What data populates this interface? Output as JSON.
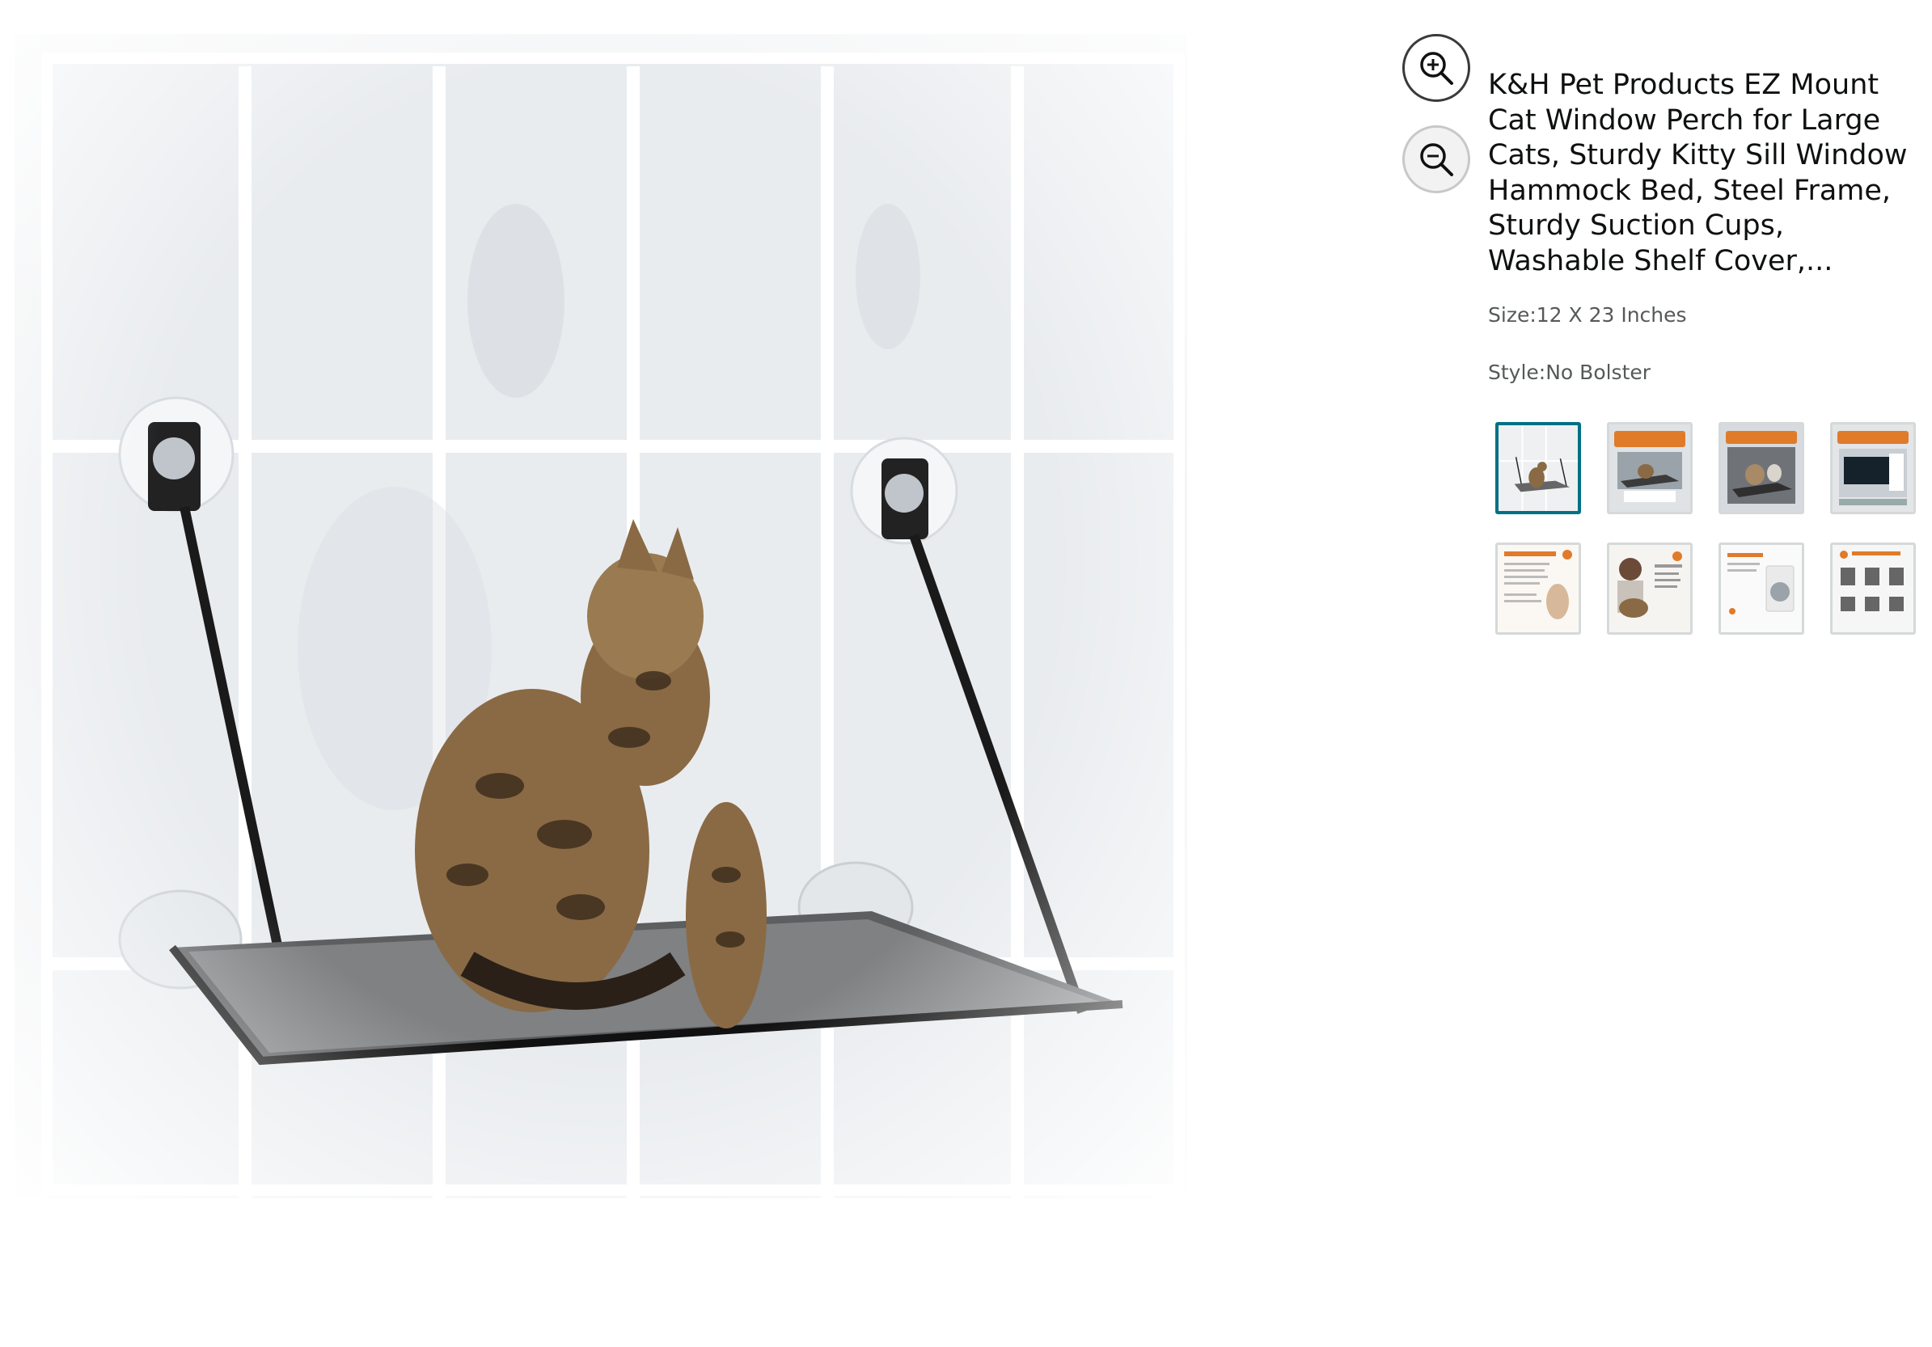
{
  "product": {
    "title": "K&H Pet Products EZ Mount Cat Window Perch for Large Cats, Sturdy Kitty Sill Window Hammock Bed, Steel Frame, Sturdy Suction Cups, Washable Shelf Cover,...",
    "size_label": "Size:",
    "size_value": "12 X 23 Inches",
    "style_label": "Style:",
    "style_value": "No Bolster"
  },
  "zoom": {
    "in_icon": "zoom-in-icon",
    "out_icon": "zoom-out-icon"
  },
  "thumbnails": {
    "count": 8,
    "selected_index": 0
  },
  "colors": {
    "selected_border": "#007185",
    "title": "#0f1111",
    "secondary_text": "#565959"
  }
}
